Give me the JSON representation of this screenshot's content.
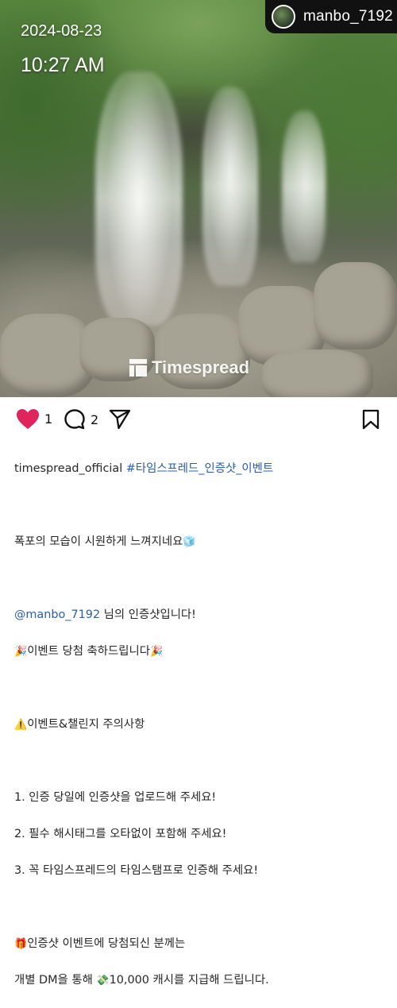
{
  "post": {
    "photo_overlay": {
      "date": "2024-08-23",
      "time": "10:27 AM",
      "user_handle": "manbo_7192",
      "watermark": "Timespread"
    },
    "actions": {
      "like_count": "1",
      "comment_count": "2",
      "icons": [
        "heart-filled-icon",
        "comment-bubble-icon",
        "send-icon",
        "bookmark-icon"
      ],
      "like_color": "#e0245e"
    },
    "caption": {
      "username": "timespread_official",
      "hashtag": "#타임스프레드_인증샷_이벤트",
      "line1": "폭포의 모습이 시원하게 느껴지네요",
      "line1_emoji": "🧊",
      "mention": "@manbo_7192",
      "mention_suffix": " 님의 인증샷입니다!",
      "congrats_emoji": "🎉",
      "congrats": "이벤트 당첨 축하드립니다",
      "warning_emoji": "⚠️",
      "notice_title": "이벤트&챌린지 주의사항",
      "rule1": "1. 인증 당일에 인증샷을 업로드해 주세요!",
      "rule2": "2. 필수 해시태그를 오타없이 포함해 주세요!",
      "rule3": "3. 꼭 타임스프레드의 타임스탬프로 인증해 주세요!",
      "gift_emoji": "🎁",
      "winner_line": "인증샷 이벤트에 당첨되신 분께는",
      "dm_line_pre": "개별 DM을 통해 ",
      "money_emoji": "💸",
      "dm_line_post": "10,000 캐시를 지급해 드립니다."
    }
  }
}
